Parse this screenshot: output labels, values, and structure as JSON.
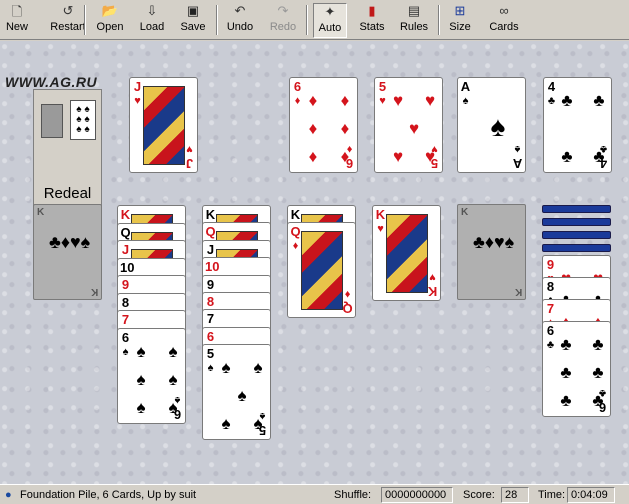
{
  "toolbar": {
    "items": [
      {
        "label": "New",
        "icon": "new-icon",
        "enabled": true,
        "active": false
      },
      {
        "label": "Restart",
        "icon": "restart-icon",
        "enabled": true,
        "active": false
      },
      {
        "label": "Open",
        "icon": "open-folder-icon",
        "enabled": true,
        "active": false
      },
      {
        "label": "Load",
        "icon": "load-icon",
        "enabled": true,
        "active": false
      },
      {
        "label": "Save",
        "icon": "save-disk-icon",
        "enabled": true,
        "active": false
      },
      {
        "label": "Undo",
        "icon": "undo-icon",
        "enabled": true,
        "active": false
      },
      {
        "label": "Redo",
        "icon": "redo-icon",
        "enabled": false,
        "active": false
      },
      {
        "label": "Auto",
        "icon": "auto-icon",
        "enabled": true,
        "active": true
      },
      {
        "label": "Stats",
        "icon": "stats-chart-icon",
        "enabled": true,
        "active": false
      },
      {
        "label": "Rules",
        "icon": "rules-book-icon",
        "enabled": true,
        "active": false
      },
      {
        "label": "Size",
        "icon": "size-icon",
        "enabled": true,
        "active": false
      },
      {
        "label": "Cards",
        "icon": "cards-binoculars-icon",
        "enabled": true,
        "active": false
      }
    ]
  },
  "logo": "WWW.AG.RU",
  "redeal": {
    "label": "Redeal"
  },
  "foundations": [
    {
      "rank": "6",
      "suit": "♦",
      "color": "red"
    },
    {
      "rank": "5",
      "suit": "♥",
      "color": "red"
    },
    {
      "rank": "A",
      "suit": "♠",
      "color": "black"
    },
    {
      "rank": "4",
      "suit": "♣",
      "color": "black"
    }
  ],
  "waste_card": {
    "rank": "J",
    "suit": "♥",
    "color": "red"
  },
  "empty_slot": {
    "rank": "K",
    "suits": "♣♦♥♠"
  },
  "tableau": [
    {
      "cards": [
        {
          "rank": "K",
          "suit": "♥",
          "color": "red"
        },
        {
          "rank": "Q",
          "suit": "♠",
          "color": "black"
        },
        {
          "rank": "J",
          "suit": "♥",
          "color": "red"
        },
        {
          "rank": "10",
          "suit": "♠",
          "color": "black"
        },
        {
          "rank": "9",
          "suit": "♦",
          "color": "red"
        },
        {
          "rank": "8",
          "suit": "♠",
          "color": "black"
        },
        {
          "rank": "7",
          "suit": "♥",
          "color": "red"
        },
        {
          "rank": "6",
          "suit": "♠",
          "color": "black"
        }
      ]
    },
    {
      "cards": [
        {
          "rank": "K",
          "suit": "♠",
          "color": "black"
        },
        {
          "rank": "Q",
          "suit": "♥",
          "color": "red"
        },
        {
          "rank": "J",
          "suit": "♠",
          "color": "black"
        },
        {
          "rank": "10",
          "suit": "♥",
          "color": "red"
        },
        {
          "rank": "9",
          "suit": "♠",
          "color": "black"
        },
        {
          "rank": "8",
          "suit": "♥",
          "color": "red"
        },
        {
          "rank": "7",
          "suit": "♠",
          "color": "black"
        },
        {
          "rank": "6",
          "suit": "♥",
          "color": "red"
        },
        {
          "rank": "5",
          "suit": "♠",
          "color": "black"
        }
      ]
    },
    {
      "cards": [
        {
          "rank": "K",
          "suit": "♠",
          "color": "black"
        },
        {
          "rank": "Q",
          "suit": "♦",
          "color": "red"
        }
      ]
    },
    {
      "cards": [
        {
          "rank": "K",
          "suit": "♥",
          "color": "red"
        }
      ]
    },
    {
      "cards": []
    },
    {
      "facedown": 4,
      "cards": [
        {
          "rank": "9",
          "suit": "♥",
          "color": "red"
        },
        {
          "rank": "8",
          "suit": "♣",
          "color": "black"
        },
        {
          "rank": "7",
          "suit": "♦",
          "color": "red"
        },
        {
          "rank": "6",
          "suit": "♣",
          "color": "black"
        }
      ]
    }
  ],
  "status": {
    "message": "Foundation Pile, 6 Cards, Up by suit",
    "shuffle_label": "Shuffle:",
    "shuffle_value": "0000000000",
    "score_label": "Score:",
    "score_value": "28",
    "time_label": "Time:",
    "time_value": "0:04:09"
  },
  "colors": {
    "felt": "#c9ccd5",
    "red": "#d4141c",
    "black": "#000000",
    "card_back": "#1a3a9a"
  }
}
